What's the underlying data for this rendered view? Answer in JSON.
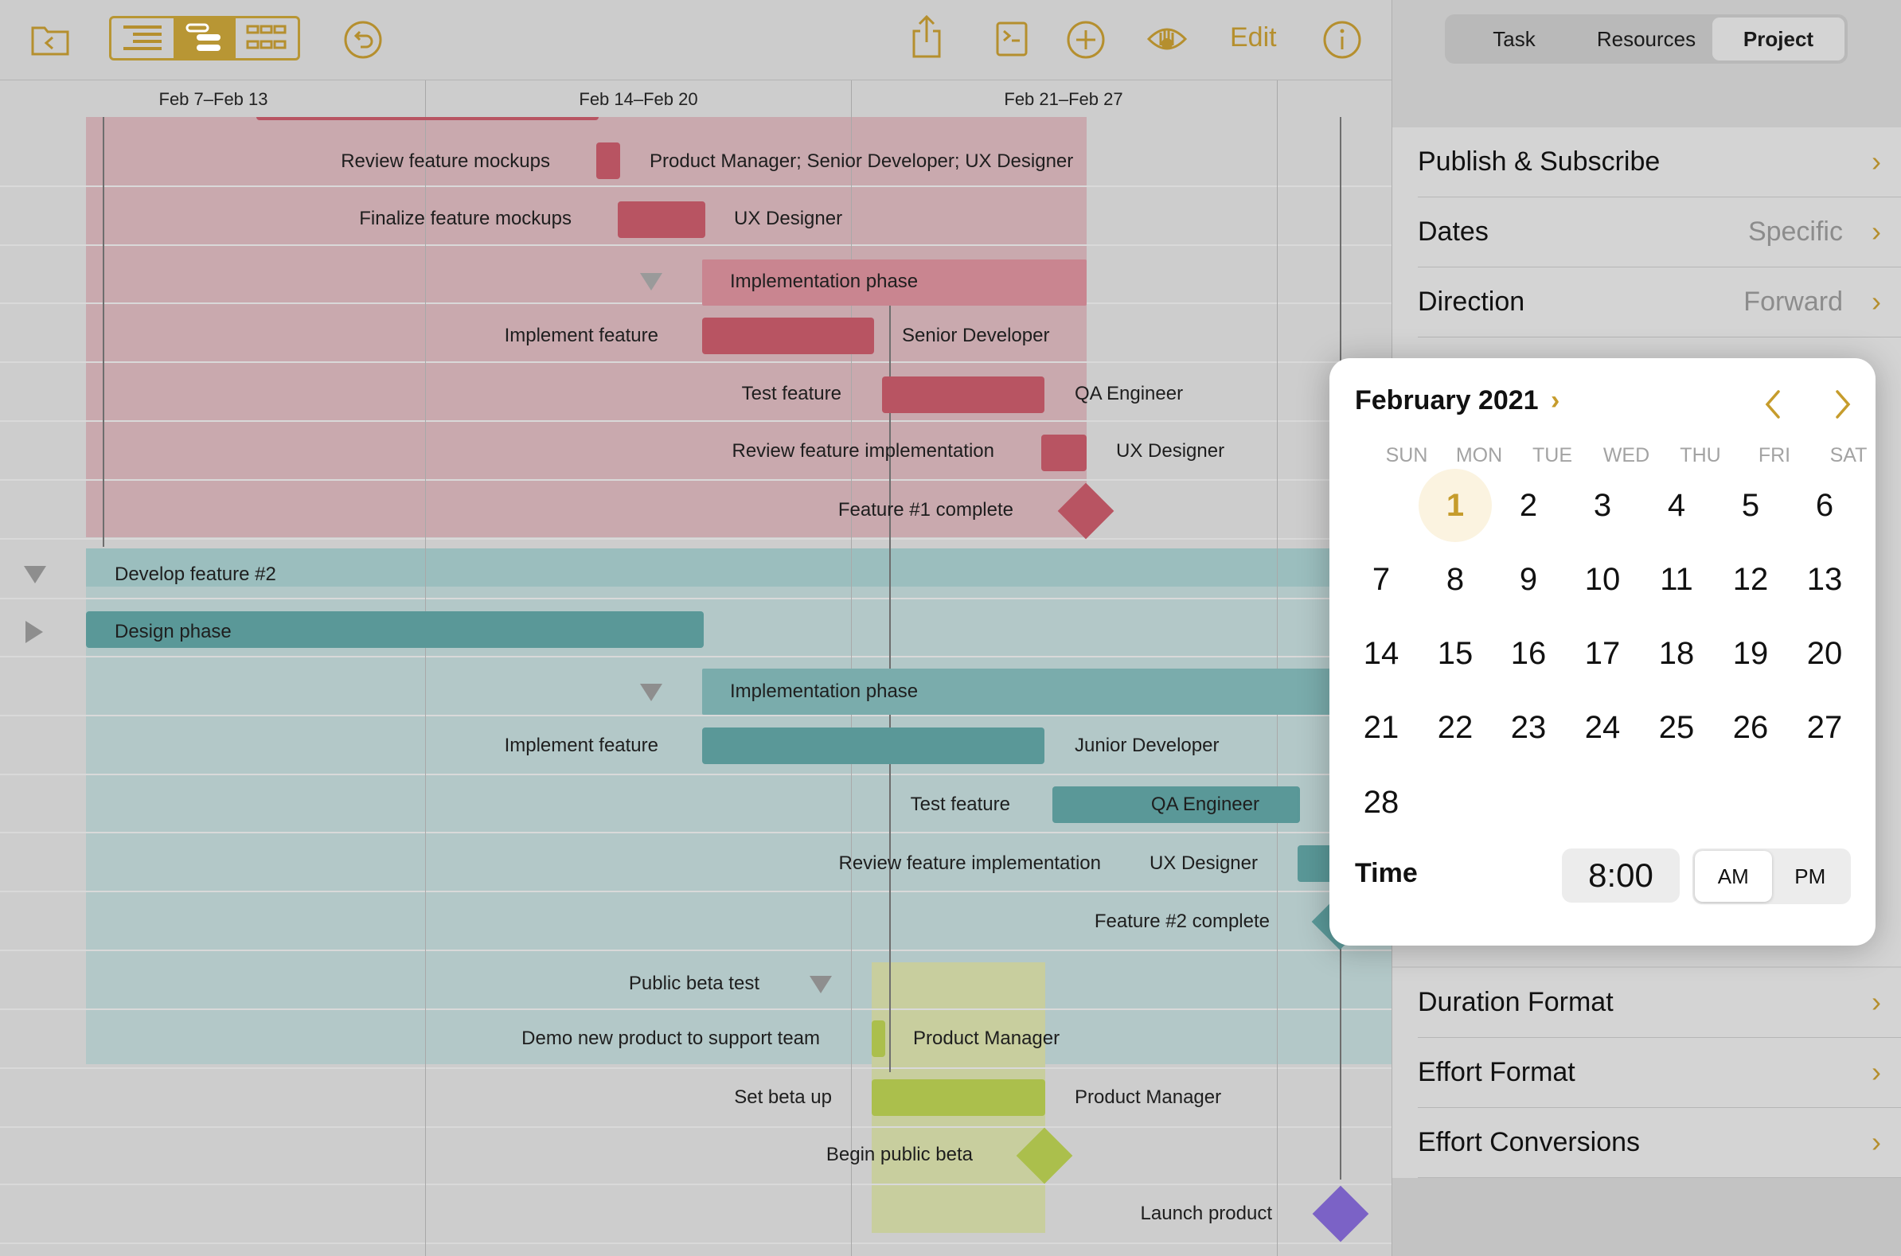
{
  "toolbar": {
    "edit_label": "Edit",
    "icons": [
      "back-to-documents-icon",
      "outline-view-icon",
      "gantt-view-icon",
      "network-view-icon",
      "undo-icon",
      "share-icon",
      "terminal-icon",
      "add-icon",
      "view-options-icon",
      "info-icon"
    ]
  },
  "timescale": {
    "weeks": [
      "Feb 7–Feb 13",
      "Feb 14–Feb 20",
      "Feb 21–Feb 27"
    ]
  },
  "gantt": {
    "colors": {
      "feature1": "#b85462",
      "feature1_band": "#c9a9ae",
      "feature2": "#5a9898",
      "feature2_band": "#a9c4c4",
      "beta": "#abbf4c",
      "beta_band": "#c8ce9e",
      "launch": "#7b62c6"
    },
    "rows": [
      {
        "label": "Review feature mockups",
        "resources": "Product Manager; Senior Developer; UX Designer"
      },
      {
        "label": "Finalize feature mockups",
        "resources": "UX Designer"
      },
      {
        "label": "Implementation phase"
      },
      {
        "label": "Implement feature",
        "resources": "Senior Developer"
      },
      {
        "label": "Test feature",
        "resources": "QA Engineer"
      },
      {
        "label": "Review feature implementation",
        "resources": "UX Designer"
      },
      {
        "label": "Feature #1 complete"
      },
      {
        "label": "Develop feature #2"
      },
      {
        "label": "Design phase"
      },
      {
        "label": "Implementation phase"
      },
      {
        "label": "Implement feature",
        "resources": "Junior Developer"
      },
      {
        "label": "Test feature",
        "resources": "QA Engineer"
      },
      {
        "label": "Review feature implementation",
        "resources": "UX Designer"
      },
      {
        "label": "Feature #2 complete"
      },
      {
        "label": "Public beta test"
      },
      {
        "label": "Demo new product to support team",
        "resources": "Product Manager"
      },
      {
        "label": "Set beta up",
        "resources": "Product Manager"
      },
      {
        "label": "Begin public beta"
      },
      {
        "label": "Launch product"
      }
    ]
  },
  "inspector": {
    "tabs": [
      "Task",
      "Resources",
      "Project"
    ],
    "selected_tab": "Project",
    "rows": [
      {
        "label": "Publish & Subscribe",
        "value": ""
      },
      {
        "label": "Dates",
        "value": "Specific"
      },
      {
        "label": "Direction",
        "value": "Forward"
      },
      {
        "label": "Duration Format",
        "value": ""
      },
      {
        "label": "Effort Format",
        "value": ""
      },
      {
        "label": "Effort Conversions",
        "value": ""
      }
    ]
  },
  "date_picker": {
    "month_title": "February 2021",
    "weekdays": [
      "SUN",
      "MON",
      "TUE",
      "WED",
      "THU",
      "FRI",
      "SAT"
    ],
    "days": [
      "1",
      "2",
      "3",
      "4",
      "5",
      "6",
      "7",
      "8",
      "9",
      "10",
      "11",
      "12",
      "13",
      "14",
      "15",
      "16",
      "17",
      "18",
      "19",
      "20",
      "21",
      "22",
      "23",
      "24",
      "25",
      "26",
      "27",
      "28"
    ],
    "selected_day": "1",
    "time_label": "Time",
    "time_value": "8:00",
    "am_label": "AM",
    "pm_label": "PM",
    "selected_period": "AM"
  }
}
